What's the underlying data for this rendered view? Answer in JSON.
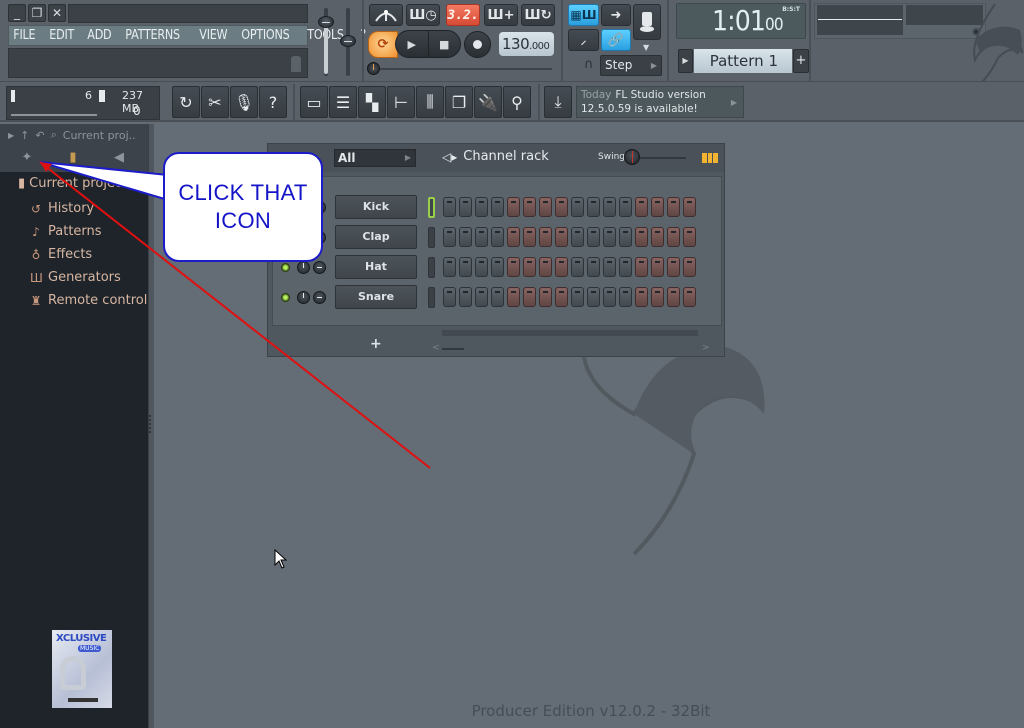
{
  "window": {
    "controls": [
      "minimize",
      "restore",
      "close"
    ],
    "title_field": ""
  },
  "menu": [
    "FILE",
    "EDIT",
    "ADD",
    "PATTERNS",
    "VIEW",
    "OPTIONS",
    "TOOLS",
    "?"
  ],
  "transport": {
    "pattern_song_mode": "3.2.",
    "tempo_main": "130",
    "tempo_decimal": ".000",
    "snap_mode": "Step",
    "accent_color": "#2a9fe0",
    "record_color": "#d64a34"
  },
  "clock": {
    "main": "1:01",
    "sub": "00",
    "format": "B:S:T"
  },
  "pattern": {
    "name": "Pattern 1",
    "add_label": "+"
  },
  "cpu_panel": {
    "polyphony": "6",
    "memory": "237 MB",
    "voices": "0"
  },
  "news": {
    "date": "Today",
    "line1": "FL Studio version",
    "line2": "12.5.0.59 is available!"
  },
  "browser": {
    "path_label": "Current proj..",
    "root": "Current project",
    "items": [
      {
        "label": "History",
        "icon": "history-icon"
      },
      {
        "label": "Patterns",
        "icon": "note-icon"
      },
      {
        "label": "Effects",
        "icon": "plugin-icon"
      },
      {
        "label": "Generators",
        "icon": "piano-icon"
      },
      {
        "label": "Remote control",
        "icon": "knob-icon"
      }
    ]
  },
  "channel_rack": {
    "title": "Channel rack",
    "filter": "All",
    "swing_label": "Swing",
    "add_label": "+",
    "channels": [
      {
        "name": "Kick",
        "selected": true
      },
      {
        "name": "Clap",
        "selected": false
      },
      {
        "name": "Hat",
        "selected": false
      },
      {
        "name": "Snare",
        "selected": false
      }
    ],
    "steps_per_row": 16,
    "step_colors": [
      "grey",
      "grey",
      "grey",
      "grey",
      "red",
      "red",
      "red",
      "red",
      "grey",
      "grey",
      "grey",
      "grey",
      "red",
      "red",
      "red",
      "red"
    ]
  },
  "annotation": {
    "line1": "CLICK THAT",
    "line2": "ICON",
    "arrow_color": "#e01010"
  },
  "footer": {
    "edition": "Producer Edition v12.0.2 - 32Bit"
  },
  "album": {
    "title": "XCLUSIVE",
    "subtitle": "MUSIC"
  }
}
